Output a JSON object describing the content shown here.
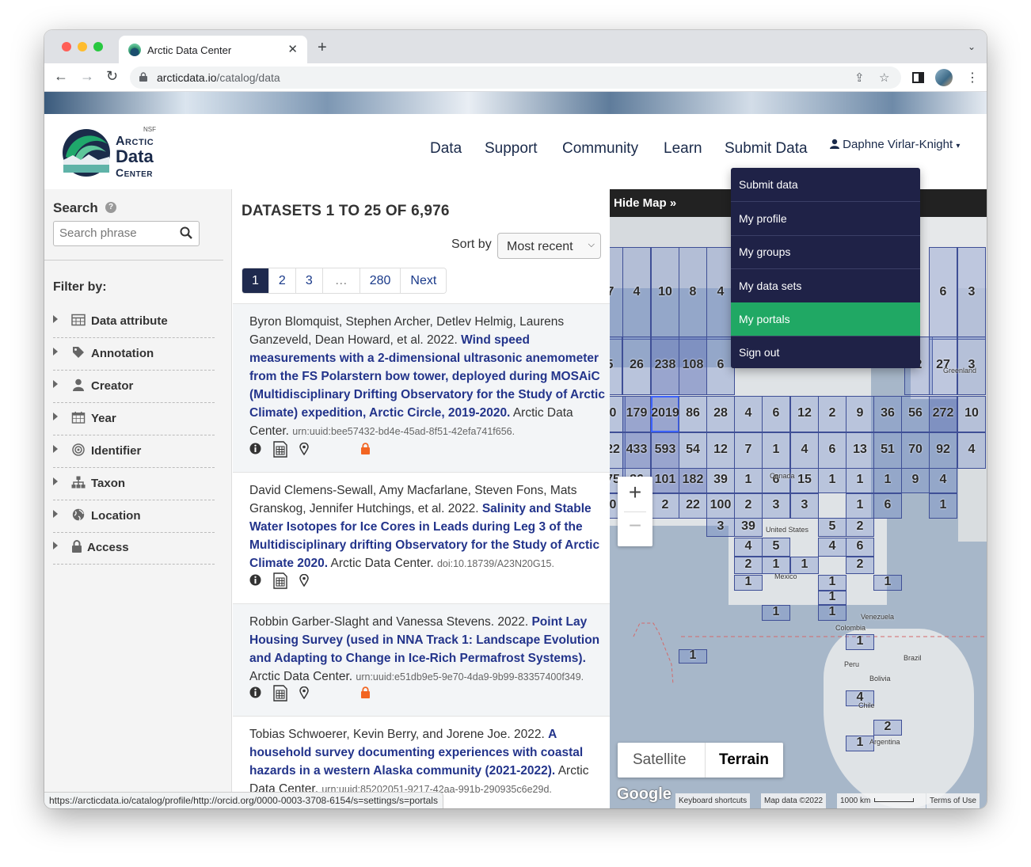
{
  "browser": {
    "tab_title": "Arctic Data Center",
    "url_host": "arcticdata.io",
    "url_path": "/catalog/data"
  },
  "site": {
    "logo": {
      "nsf": "NSF",
      "line1": "Arctic",
      "line2": "Data",
      "line3": "Center"
    },
    "nav": [
      "Data",
      "Support",
      "Community",
      "Learn",
      "Submit Data"
    ],
    "user_name": "Daphne Virlar-Knight"
  },
  "dropdown": {
    "items": [
      "Submit data",
      "My profile",
      "My groups",
      "My data sets",
      "My portals",
      "Sign out"
    ],
    "active": "My portals"
  },
  "sidebar": {
    "search_label": "Search",
    "search_placeholder": "Search phrase",
    "filter_label": "Filter by:",
    "filters": [
      "Data attribute",
      "Annotation",
      "Creator",
      "Year",
      "Identifier",
      "Taxon",
      "Location",
      "Access"
    ]
  },
  "results": {
    "heading": "DATASETS 1 TO 25 OF 6,976",
    "sort_label": "Sort by",
    "sort_value": "Most recent",
    "pages": [
      "1",
      "2",
      "3",
      "…",
      "280",
      "Next"
    ],
    "records": [
      {
        "authors": "Byron Blomquist, Stephen Archer, Detlev Helmig, Laurens Ganzeveld, Dean Howard, et al. 2022.",
        "title": "Wind speed measurements with a 2-dimensional ultrasonic anemometer from the FS Polarstern bow tower, deployed during MOSAiC (Multidisciplinary Drifting Observatory for the Study of Arctic Climate) expedition, Arctic Circle, 2019-2020.",
        "publisher": "Arctic Data Center.",
        "id": "urn:uuid:bee57432-bd4e-45ad-8f51-42efa741f656."
      },
      {
        "authors": "David Clemens-Sewall, Amy Macfarlane, Steven Fons, Mats Granskog, Jennifer Hutchings, et al. 2022.",
        "title": "Salinity and Stable Water Isotopes for Ice Cores in Leads during Leg 3 of the Multidisciplinary drifting Observatory for the Study of Arctic Climate 2020.",
        "publisher": "Arctic Data Center.",
        "id": "doi:10.18739/A23N20G15."
      },
      {
        "authors": "Robbin Garber-Slaght and Vanessa Stevens. 2022.",
        "title": "Point Lay Housing Survey (used in NNA Track 1: Landscape Evolution and Adapting to Change in Ice-Rich Permafrost Systems).",
        "publisher": "Arctic Data Center.",
        "id": "urn:uuid:e51db9e5-9e70-4da9-9b99-83357400f349."
      },
      {
        "authors": "Tobias Schwoerer, Kevin Berry, and Jorene Joe. 2022.",
        "title": "A household survey documenting experiences with coastal hazards in a western Alaska community (2021-2022).",
        "publisher": "Arctic Data Center.",
        "id": "urn:uuid:85202051-9217-42aa-991b-290935c6e29d."
      }
    ]
  },
  "map": {
    "hide_label": "Hide Map »",
    "map_types": [
      "Satellite",
      "Terrain"
    ],
    "selected_type": "Terrain",
    "google": "Google",
    "attribution": [
      "Keyboard shortcuts",
      "Map data ©2022",
      "1000 km",
      "Terms of Use"
    ],
    "place_labels": [
      "Greenland",
      "Canada",
      "United States",
      "Mexico",
      "Venezuela",
      "Colombia",
      "Brazil",
      "Peru",
      "Bolivia",
      "Chile",
      "Argentina"
    ],
    "counts": [
      "7",
      "4",
      "10",
      "8",
      "4",
      "6",
      "3",
      "5",
      "26",
      "238",
      "108",
      "6",
      "2",
      "27",
      "3",
      "0",
      "179",
      "2019",
      "86",
      "28",
      "4",
      "6",
      "12",
      "2",
      "9",
      "36",
      "56",
      "272",
      "10",
      "22",
      "433",
      "593",
      "54",
      "12",
      "7",
      "1",
      "4",
      "6",
      "13",
      "51",
      "70",
      "92",
      "4",
      "75",
      "86",
      "101",
      "182",
      "39",
      "1",
      "6",
      "15",
      "1",
      "1",
      "1",
      "9",
      "4",
      "0",
      "7",
      "2",
      "22",
      "100",
      "2",
      "3",
      "3",
      "1",
      "6",
      "1",
      "3",
      "39",
      "5",
      "2",
      "4",
      "5",
      "4",
      "6",
      "2",
      "1",
      "1",
      "2",
      "1",
      "1",
      "1",
      "1",
      "1",
      "1",
      "1",
      "1",
      "4",
      "2",
      "1",
      "1"
    ]
  },
  "status_url": "https://arcticdata.io/catalog/profile/http://orcid.org/0000-0003-3708-6154/s=settings/s=portals"
}
